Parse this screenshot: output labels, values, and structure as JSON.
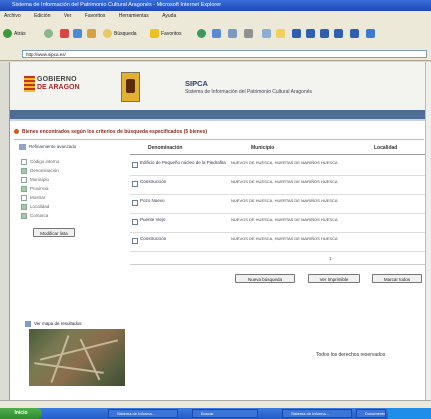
{
  "window": {
    "title": "Sistema de Información del Patrimonio Cultural Aragonés - Microsoft Internet Explorer"
  },
  "menu": [
    "Archivo",
    "Edición",
    "Ver",
    "Favoritos",
    "Herramientas",
    "Ayuda"
  ],
  "toolbar": {
    "back": "Atrás",
    "search": "Búsqueda",
    "favorites": "Favoritos"
  },
  "address": {
    "label": "Dirección",
    "value": "http://www.sipca.es/"
  },
  "banner": {
    "logo_line1": "GOBIERNO",
    "logo_line2": "DE ARAGON",
    "title": "SIPCA",
    "subtitle": "Sistema de Información del Patrimonio Cultural Aragonés"
  },
  "message": "Bienes encontrados según los criterios de búsqueda especificados (5 bienes)",
  "left": {
    "refine_label": "Refinamiento avanzado",
    "checks": [
      {
        "label": "Código interno",
        "checked": false
      },
      {
        "label": "Denominación",
        "checked": true
      },
      {
        "label": "Municipio",
        "checked": false
      },
      {
        "label": "Provincia",
        "checked": true
      },
      {
        "label": "Mostrar",
        "checked": false
      },
      {
        "label": "Localidad",
        "checked": true
      },
      {
        "label": "Comarca",
        "checked": true
      }
    ],
    "modify_button": "Modificar lista",
    "map_label": "Ver mapa de resultados"
  },
  "table": {
    "headers": [
      "Denominación",
      "Municipio",
      "Localidad"
    ],
    "rows": [
      {
        "denominacion": "Edificio de Pequeño núcleo de la Piedrafita",
        "municipio": "NUEVOS DE HUESCA, HUERTAS DE MARIÑOS HUESCA"
      },
      {
        "denominacion": "Construcción",
        "municipio": "NUEVOS DE HUESCA, HUERTAS DE MARIÑOS HUESCA"
      },
      {
        "denominacion": "Pozo Nuevo",
        "municipio": "NUEVOS DE HUESCA, HUERTAS DE MARIÑOS HUESCA"
      },
      {
        "denominacion": "Puente Viejo",
        "municipio": "NUEVOS DE HUESCA, HUERTAS DE MARIÑOS HUESCA"
      },
      {
        "denominacion": "Construcción",
        "municipio": "NUEVOS DE HUESCA, HUERTAS DE MARIÑOS HUESCA"
      }
    ],
    "hint": "1"
  },
  "actions": [
    "Nueva búsqueda",
    "Ver Imprimible",
    "Marcar todos"
  ],
  "footer": "Todos los derechos reservados",
  "taskbar": {
    "start": "Inicio",
    "tasks": [
      "Sistema de Informa...",
      "Buscar",
      "Sistema de Informa...",
      "Documento"
    ]
  }
}
